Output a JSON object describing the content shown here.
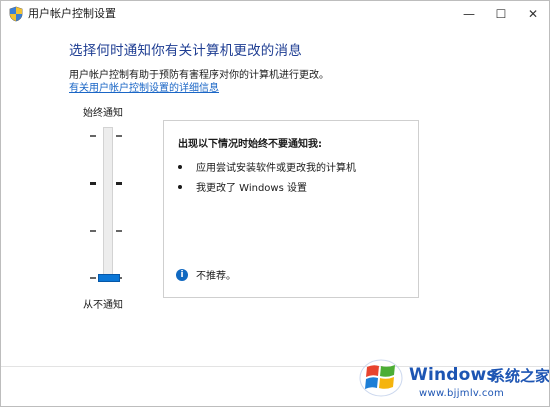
{
  "window": {
    "title": "用户帐户控制设置",
    "controls": {
      "minimize": "—",
      "maximize": "☐",
      "close": "✕"
    }
  },
  "main": {
    "heading": "选择何时通知你有关计算机更改的消息",
    "description": "用户帐户控制有助于预防有害程序对你的计算机进行更改。",
    "link_text": "有关用户帐户控制设置的详细信息"
  },
  "slider": {
    "top_label": "始终通知",
    "bottom_label": "从不通知",
    "levels": 4,
    "selected_level": 1
  },
  "info_panel": {
    "heading": "出现以下情况时始终不要通知我:",
    "bullets": [
      "应用尝试安装软件或更改我的计算机",
      "我更改了 Windows 设置"
    ],
    "note": "不推荐。",
    "note_icon": "info-icon"
  },
  "watermark": {
    "windows_text": "Windows",
    "brand_text": "系统之家",
    "url": "www.bjjmlv.com",
    "logo_colors": [
      "#e8432e",
      "#4cae35",
      "#1d7ed6",
      "#f5b40d"
    ]
  },
  "colors": {
    "heading": "#1f3e93",
    "link": "#1a66c6",
    "slider_thumb": "#0a76d6"
  }
}
